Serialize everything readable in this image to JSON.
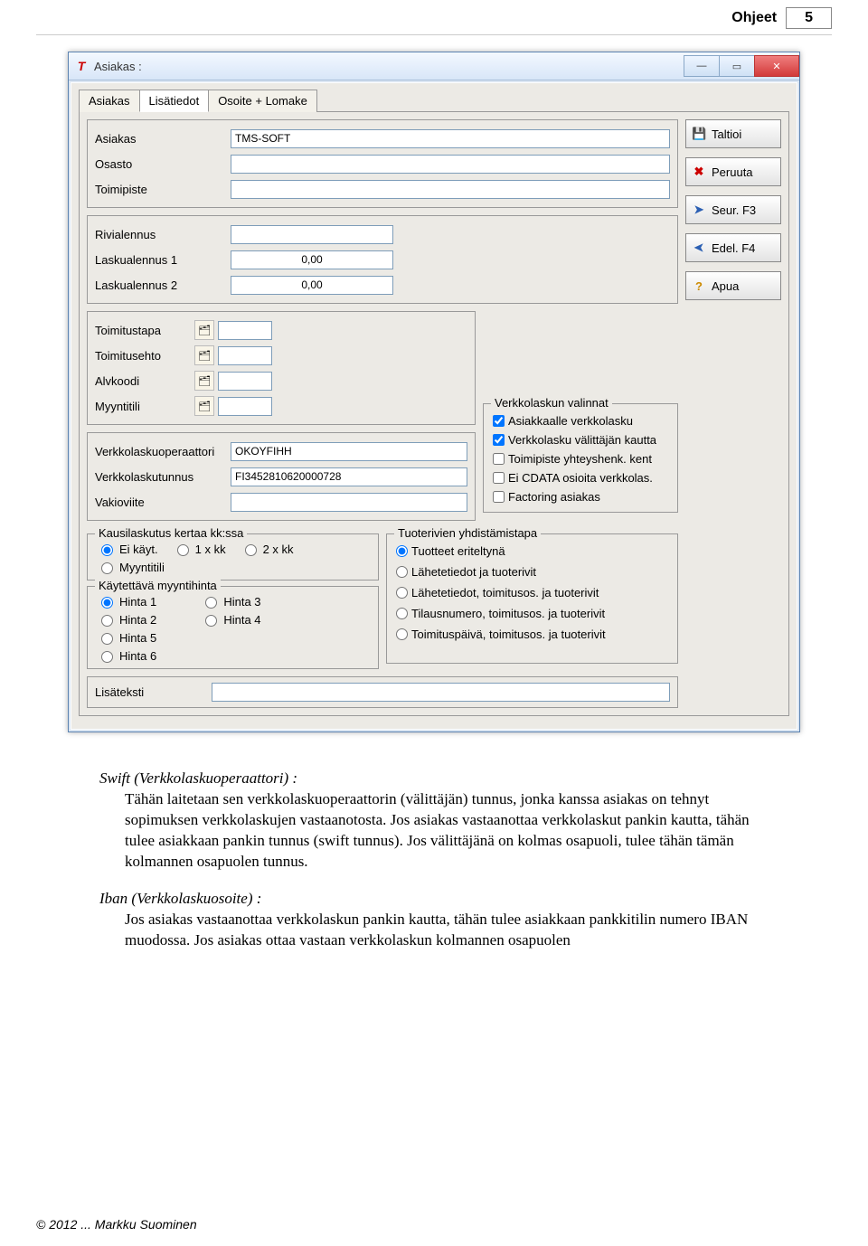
{
  "header": {
    "title": "Ohjeet",
    "page": "5"
  },
  "window": {
    "icon": "T",
    "title": "Asiakas :"
  },
  "tabs": [
    "Asiakas",
    "Lisätiedot",
    "Osoite + Lomake"
  ],
  "active_tab": 1,
  "fields_top": {
    "asiakas_lbl": "Asiakas",
    "asiakas_val": "TMS-SOFT",
    "osasto_lbl": "Osasto",
    "osasto_val": "",
    "toimipiste_lbl": "Toimipiste",
    "toimipiste_val": ""
  },
  "fields_disc": {
    "rivi_lbl": "Rivialennus",
    "rivi_val": "",
    "la1_lbl": "Laskualennus 1",
    "la1_val": "0,00",
    "la2_lbl": "Laskualennus 2",
    "la2_val": "0,00"
  },
  "fields_mid": {
    "toimitustapa_lbl": "Toimitustapa",
    "toimitusehto_lbl": "Toimitusehto",
    "alvkoodi_lbl": "Alvkoodi",
    "myyntitili_lbl": "Myyntitili"
  },
  "fields_vl": {
    "op_lbl": "Verkkolaskuoperaattori",
    "op_val": "OKOYFIHH",
    "tun_lbl": "Verkkolaskutunnus",
    "tun_val": "FI3452810620000728",
    "vak_lbl": "Vakioviite",
    "vak_val": ""
  },
  "buttons": {
    "save": "Taltioi",
    "cancel": "Peruuta",
    "next": "Seur. F3",
    "prev": "Edel. F4",
    "help": "Apua"
  },
  "valinnat": {
    "title": "Verkkolaskun valinnat",
    "a": "Asiakkaalle verkkolasku",
    "b": "Verkkolasku välittäjän kautta",
    "c": "Toimipiste yhteyshenk. kent",
    "d": "Ei CDATA osioita verkkolas.",
    "e": "Factoring asiakas"
  },
  "kausi": {
    "title": "Kausilaskutus kertaa kk:ssa",
    "r1": "Ei käyt.",
    "r2": "1 x kk",
    "r3": "2 x kk",
    "r4": "Myyntitili"
  },
  "hinta": {
    "title": "Käytettävä myyntihinta",
    "h1": "Hinta 1",
    "h2": "Hinta 2",
    "h3": "Hinta 3",
    "h4": "Hinta 4",
    "h5": "Hinta 5",
    "h6": "Hinta 6"
  },
  "yhd": {
    "title": "Tuoterivien yhdistämistapa",
    "o1": "Tuotteet eriteltynä",
    "o2": "Lähetetiedot ja tuoterivit",
    "o3": "Lähetetiedot, toimitusos. ja tuoterivit",
    "o4": "Tilausnumero, toimitusos. ja tuoterivit",
    "o5": "Toimituspäivä, toimitusos. ja tuoterivit"
  },
  "lisateksti_lbl": "Lisäteksti",
  "doc": {
    "swift_h": "Swift (Verkkolaskuoperaattori) :",
    "swift_b": "Tähän laitetaan sen verkkolaskuoperaattorin (välittäjän) tunnus, jonka kanssa asiakas on tehnyt sopimuksen verkkolaskujen vastaanotosta. Jos asiakas vastaanottaa verkkolaskut pankin kautta, tähän tulee asiakkaan pankin tunnus (swift tunnus). Jos välittäjänä on kolmas osapuoli, tulee tähän tämän kolmannen osapuolen tunnus.",
    "iban_h": "Iban (Verkkolaskuosoite) :",
    "iban_b": "Jos asiakas vastaanottaa verkkolaskun pankin kautta, tähän tulee asiakkaan pankkitilin numero IBAN muodossa. Jos asiakas ottaa vastaan verkkolaskun kolmannen osapuolen"
  },
  "footer": "© 2012 ... Markku Suominen"
}
